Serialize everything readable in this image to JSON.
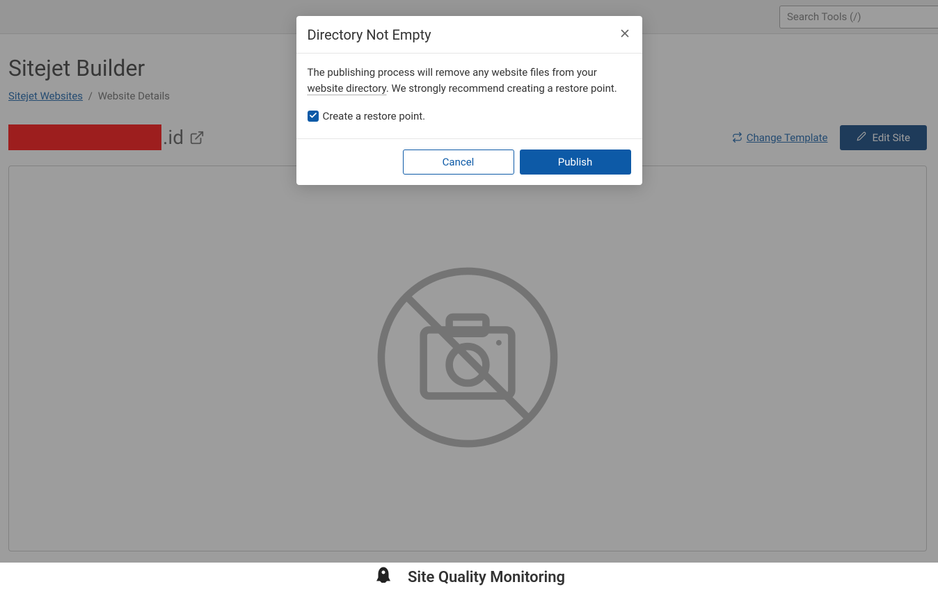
{
  "search": {
    "placeholder": "Search Tools (/)"
  },
  "page": {
    "title": "Sitejet Builder",
    "breadcrumb": {
      "link_label": "Sitejet Websites",
      "separator": "/",
      "current": "Website Details"
    },
    "domain_suffix": ".id",
    "change_template_label": "Change Template",
    "edit_site_label": "Edit Site",
    "bottom_section_title": "Site Quality Monitoring"
  },
  "modal": {
    "title": "Directory Not Empty",
    "body_text_1": "The publishing process will remove any website files from your ",
    "body_underlined": "website directory",
    "body_text_2": ". We strongly recommend creating a restore point.",
    "checkbox_label": "Create a restore point.",
    "cancel_label": "Cancel",
    "publish_label": "Publish"
  }
}
